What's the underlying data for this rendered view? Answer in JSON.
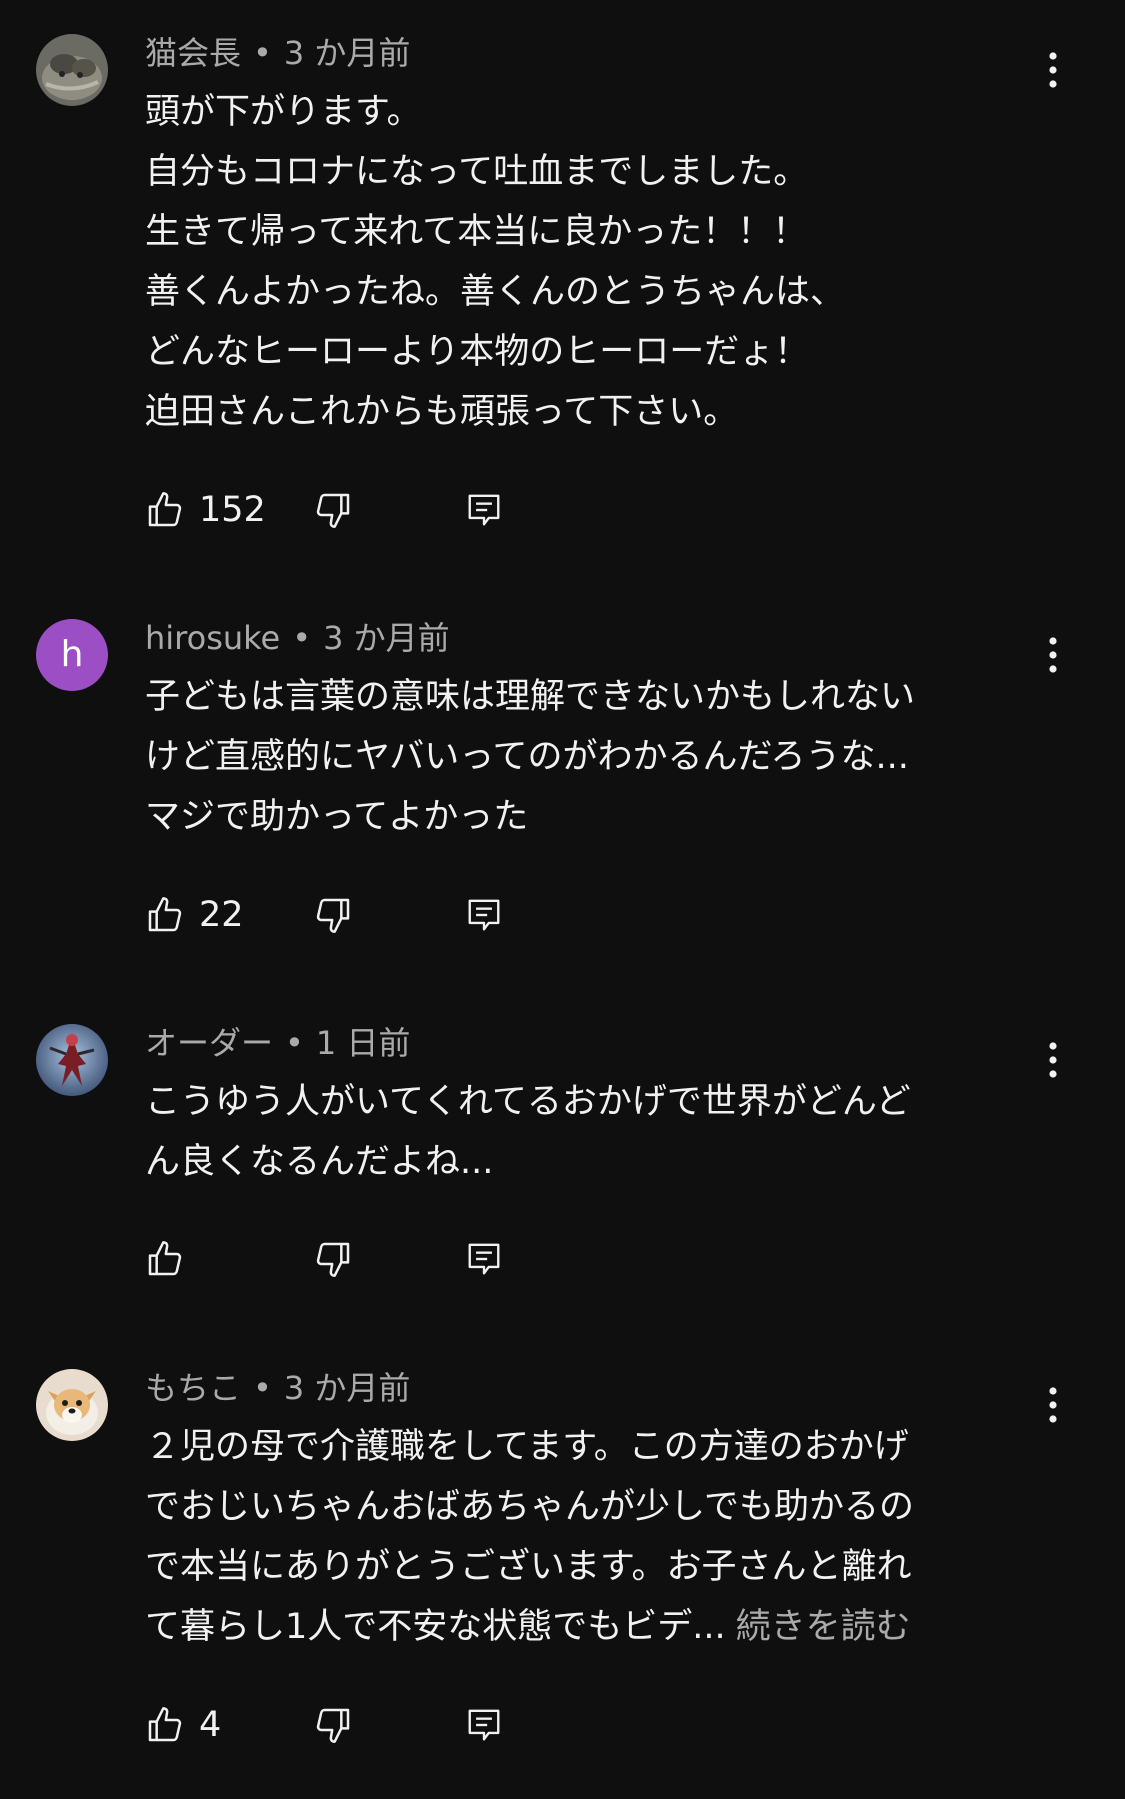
{
  "icons": {
    "like": "thumbs-up-icon",
    "dislike": "thumbs-down-icon",
    "reply": "reply-comment-icon",
    "more": "more-vertical-icon"
  },
  "colors": {
    "background": "#0f0f0f",
    "text": "#f1f1f1",
    "secondary": "#aaaaaa",
    "avatar_h": "#9c4fc4"
  },
  "comments": [
    {
      "author": "猫会長",
      "time": "3 か月前",
      "lines": [
        "頭が下がります。",
        "自分もコロナになって吐血までしました。",
        "生きて帰って来れて本当に良かった！！！",
        "善くんよかったね。善くんのとうちゃんは、",
        "どんなヒーローより本物のヒーローだょ！",
        "迫田さんこれからも頑張って下さい。"
      ],
      "likes": "152"
    },
    {
      "author": "hirosuke",
      "avatar_letter": "h",
      "time": "3 か月前",
      "lines": [
        "子どもは言葉の意味は理解できないかもしれない",
        "けど直感的にヤバいってのがわかるんだろうな...",
        "マジで助かってよかった"
      ],
      "likes": "22"
    },
    {
      "author": "オーダー",
      "time": "1 日前",
      "lines": [
        "こうゆう人がいてくれてるおかげで世界がどんど",
        "ん良くなるんだよね..."
      ],
      "likes": ""
    },
    {
      "author": "もちこ",
      "time": "3 か月前",
      "lines": [
        "２児の母で介護職をしてます。この方達のおかげ",
        "でおじいちゃんおばあちゃんが少しでも助かるの",
        "で本当にありがとうございます。お子さんと離れ",
        "て暮らし1人で不安な状態でもビデ..."
      ],
      "read_more": "続きを読む",
      "likes": "4"
    }
  ]
}
